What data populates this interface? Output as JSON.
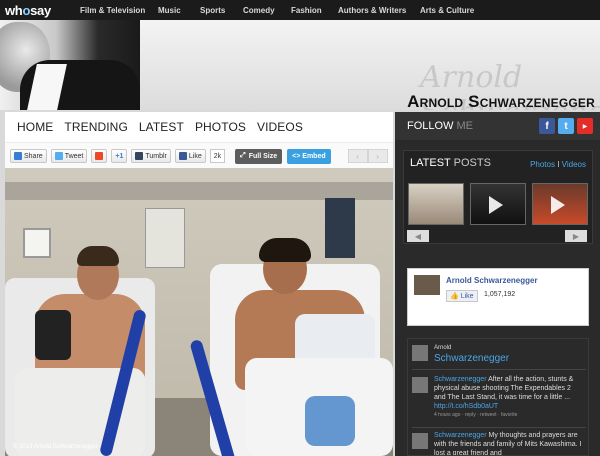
{
  "top_nav": {
    "logo_main": "wh",
    "logo_accent": "o",
    "logo_end": "say",
    "items": [
      "Film & Television",
      "Music",
      "Sports",
      "Comedy",
      "Fashion",
      "Authors & Writers",
      "Arts & Culture"
    ]
  },
  "banner": {
    "name": "Arnold Schwarzenegger",
    "signature": "Arnold Schwarzenegger"
  },
  "subnav": [
    "HOME",
    "TRENDING",
    "LATEST",
    "PHOTOS",
    "VIDEOS"
  ],
  "share": {
    "share": "Share",
    "tweet": "Tweet",
    "plus": "+1",
    "tumblr": "Tumblr",
    "like": "Like",
    "like_count": "2k",
    "full_size": "Full Size",
    "embed": "<> Embed",
    "prev": "‹",
    "next": "›"
  },
  "photo": {
    "watermark": "© 2013 Arnold Schwarzenegger"
  },
  "sidebar": {
    "follow": "FOLLOW",
    "follow_me": "ME",
    "latest_title": "LATEST",
    "latest_title_thin": "POSTS",
    "latest_photos": "Photos",
    "latest_sep": "I",
    "latest_videos": "Videos",
    "prev": "◀",
    "next": "▶",
    "facebook": {
      "name": "Arnold Schwarzenegger",
      "like": "Like",
      "count": "1,057,192"
    },
    "twitter": {
      "header_small": "Arnold",
      "header_handle": "Schwarzenegger",
      "tweets": [
        {
          "handle": "Schwarzenegger",
          "text": "After all the action, stunts & physical abuse shooting The Expendables 2 and The Last Stand, it was time for a little ...",
          "link": "http://t.co/hSdb0aUT",
          "meta": "4 hours ago · reply · retweet · favorite"
        },
        {
          "handle": "Schwarzenegger",
          "text": "My thoughts and prayers are with the friends and family of Mits Kawashima. I lost a great friend and",
          "link": "",
          "meta": ""
        }
      ]
    }
  }
}
